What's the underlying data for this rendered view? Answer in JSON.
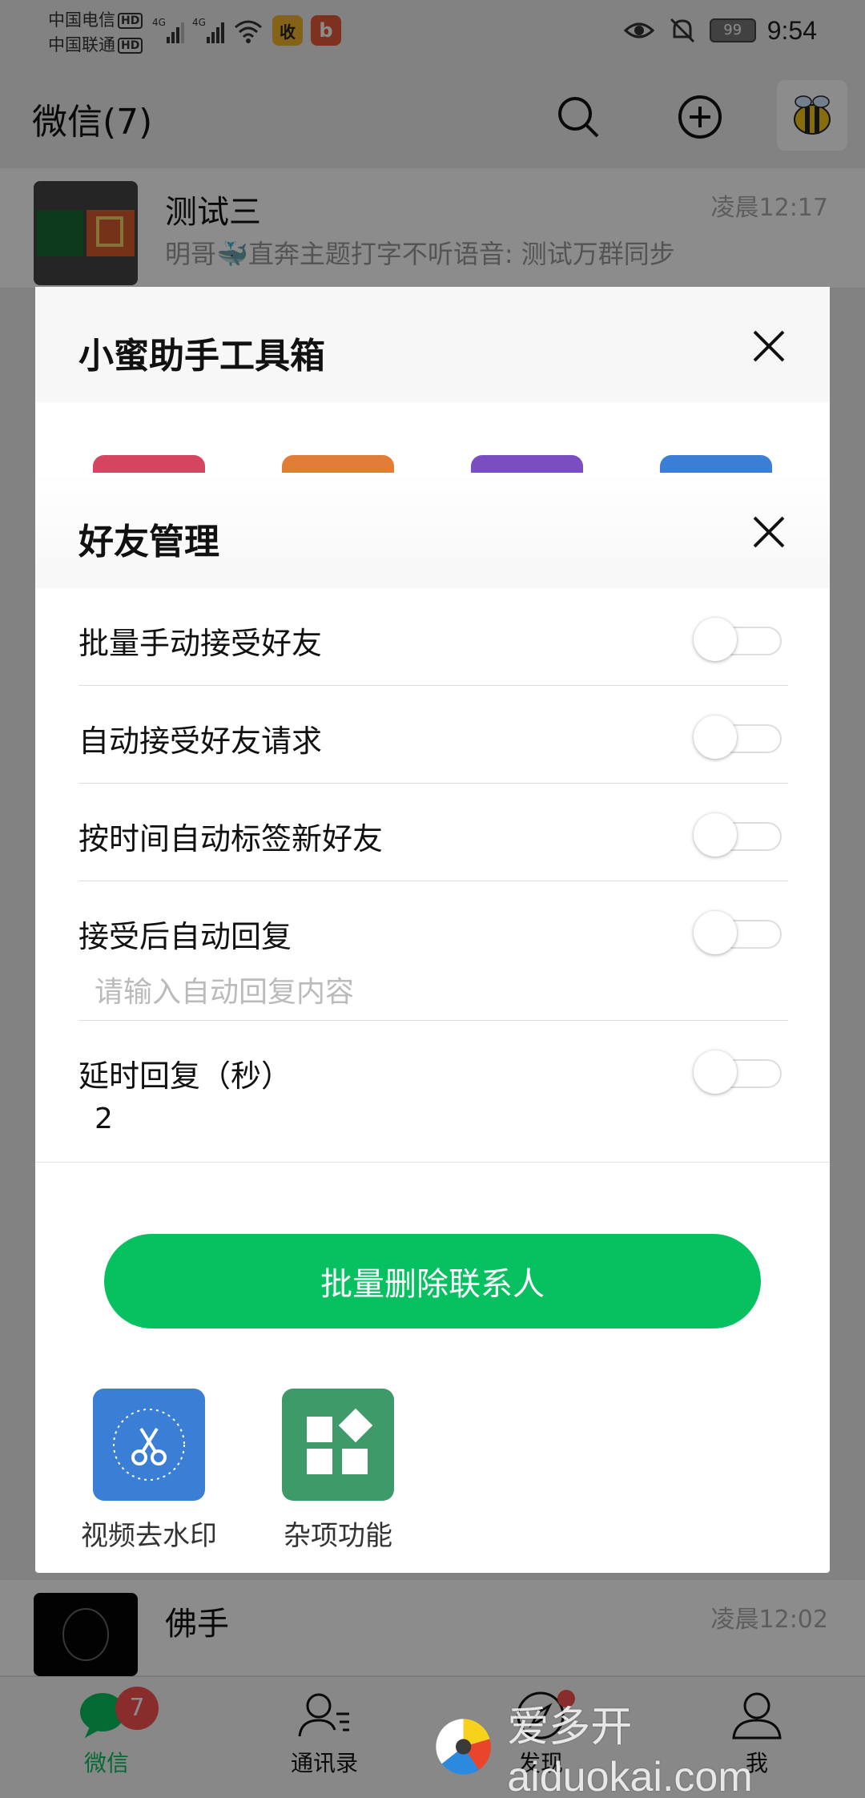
{
  "status_bar": {
    "carrier1": "中国电信",
    "carrier2": "中国联通",
    "hd": "HD",
    "net_type": "4G",
    "app_icon1": "收",
    "app_icon2": "b",
    "battery": "99",
    "time": "9:54"
  },
  "header": {
    "title": "微信(7)",
    "icons": [
      "search-icon",
      "add-circle-icon",
      "bee-avatar"
    ]
  },
  "chats": [
    {
      "name": "测试三",
      "time": "凌晨12:17",
      "preview": "明哥🐳直奔主题打字不听语音: 测试万群同步"
    },
    {
      "name": "佛手",
      "time": "凌晨12:02",
      "preview": ""
    }
  ],
  "toolbox": {
    "title": "小蜜助手工具箱",
    "tools": [
      {
        "label": "视频去水印",
        "icon": "scissors-icon",
        "color": "#3a7fd5"
      },
      {
        "label": "杂项功能",
        "icon": "grid-icon",
        "color": "#3f9a6a"
      }
    ],
    "top_tool_colors": [
      "#d6455f",
      "#e27d36",
      "#7a4ec0",
      "#3a7fd5"
    ]
  },
  "dialog": {
    "title": "好友管理",
    "settings": [
      {
        "label": "批量手动接受好友",
        "enabled": false
      },
      {
        "label": "自动接受好友请求",
        "enabled": false
      },
      {
        "label": "按时间自动标签新好友",
        "enabled": false
      },
      {
        "label": "接受后自动回复",
        "enabled": false
      },
      {
        "label": "延时回复（秒）",
        "enabled": false
      }
    ],
    "auto_reply_placeholder": "请输入自动回复内容",
    "delay_value": "2",
    "button_label": "批量删除联系人"
  },
  "bottom_nav": {
    "items": [
      {
        "label": "微信",
        "badge": "7",
        "active": true
      },
      {
        "label": "通讯录"
      },
      {
        "label": "发现",
        "dot": true
      },
      {
        "label": "我"
      }
    ]
  },
  "watermark": {
    "text": "爱多开aiduokai.com"
  },
  "colors": {
    "accent": "#07c160",
    "badge": "#fa5151"
  }
}
